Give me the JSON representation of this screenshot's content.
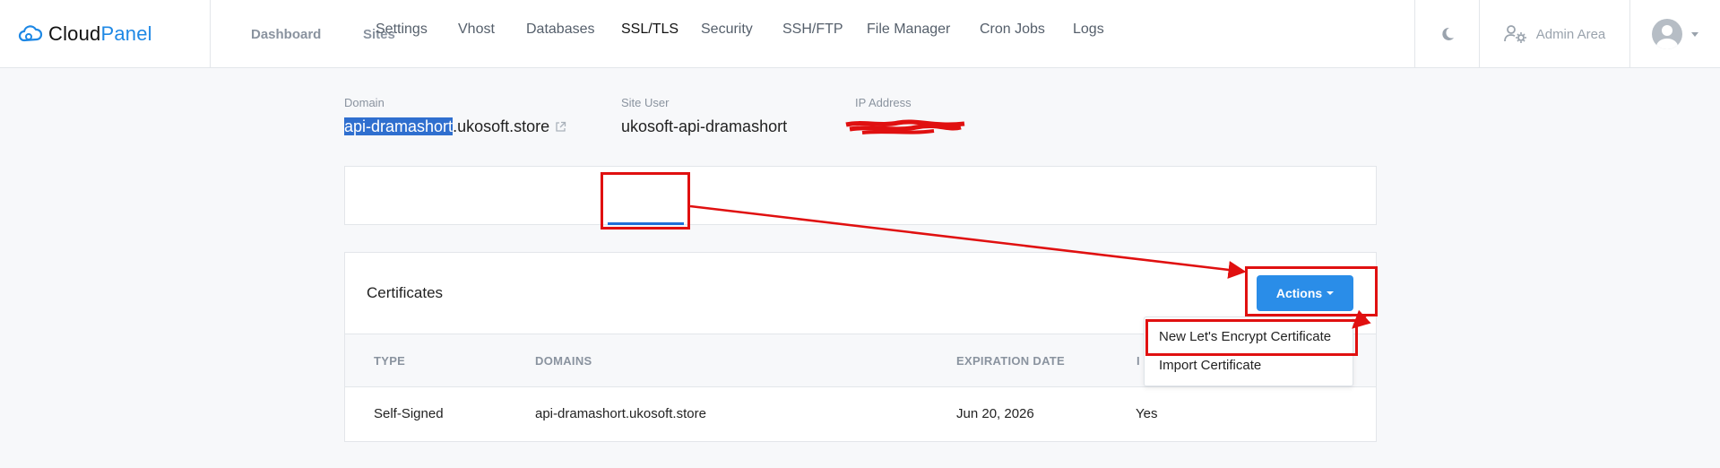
{
  "brand": {
    "name_part1": "Cloud",
    "name_part2": "Panel"
  },
  "nav": {
    "dashboard": "Dashboard",
    "sites": "Sites"
  },
  "topbar": {
    "admin_area": "Admin Area"
  },
  "site_info": {
    "domain_label": "Domain",
    "domain_selected": "api-dramashort",
    "domain_rest": ".ukosoft.store",
    "site_user_label": "Site User",
    "site_user": "ukosoft-api-dramashort",
    "ip_label": "IP Address"
  },
  "tabs": [
    "Settings",
    "Vhost",
    "Databases",
    "SSL/TLS",
    "Security",
    "SSH/FTP",
    "File Manager",
    "Cron Jobs",
    "Logs"
  ],
  "active_tab": "SSL/TLS",
  "certificates": {
    "title": "Certificates",
    "actions_label": "Actions",
    "columns": [
      "TYPE",
      "DOMAINS",
      "EXPIRATION DATE",
      "I"
    ],
    "rows": [
      {
        "type": "Self-Signed",
        "domains": "api-dramashort.ukosoft.store",
        "expiration": "Jun 20, 2026",
        "installed": "Yes"
      }
    ]
  },
  "actions_menu": {
    "items": [
      "New Let's Encrypt Certificate",
      "Import Certificate"
    ]
  },
  "colors": {
    "accent": "#1e88e5",
    "button": "#2a8de8",
    "annotation": "#e01010",
    "selection": "#2f6fcf"
  },
  "icons": [
    "cloud-logo-icon",
    "moon-icon",
    "users-gear-icon",
    "avatar-icon",
    "external-link-icon"
  ]
}
